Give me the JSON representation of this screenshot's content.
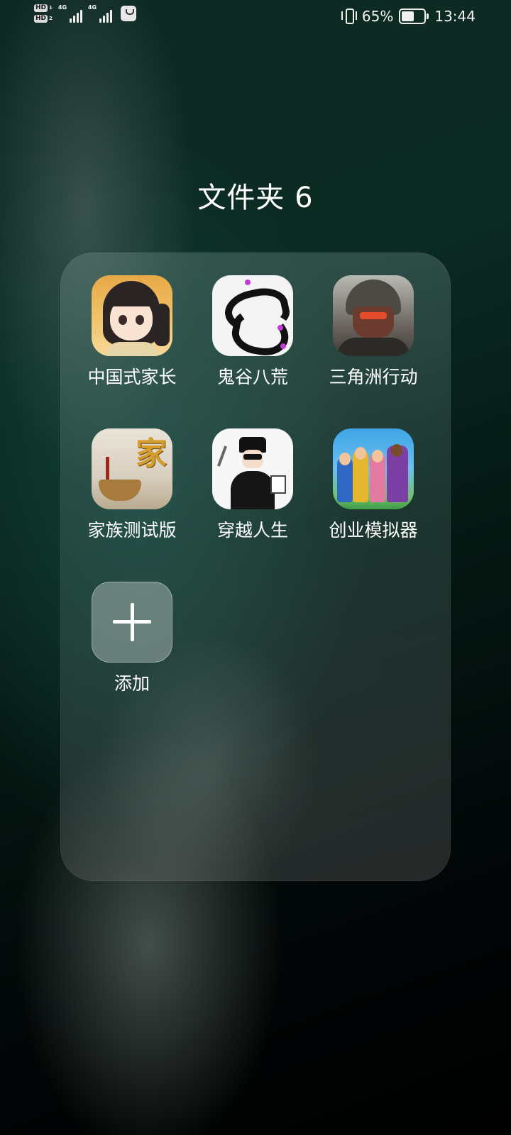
{
  "status_bar": {
    "hd1": "HD",
    "hd1_num": "1",
    "hd2": "HD",
    "hd2_num": "2",
    "net1": "4G",
    "net2": "4G",
    "battery_percent_label": "65%",
    "battery_level": 0.65,
    "time": "13:44"
  },
  "folder": {
    "title": "文件夹 6",
    "apps": [
      {
        "label": "中国式家长",
        "icon": "chinese-parent-app-icon"
      },
      {
        "label": "鬼谷八荒",
        "icon": "guigu-bahuang-app-icon"
      },
      {
        "label": "三角洲行动",
        "icon": "delta-force-app-icon"
      },
      {
        "label": "家族测试版",
        "icon": "family-beta-app-icon"
      },
      {
        "label": "穿越人生",
        "icon": "crossing-life-app-icon"
      },
      {
        "label": "创业模拟器",
        "icon": "startup-simulator-app-icon"
      }
    ],
    "add": {
      "label": "添加",
      "icon": "plus-icon"
    }
  }
}
